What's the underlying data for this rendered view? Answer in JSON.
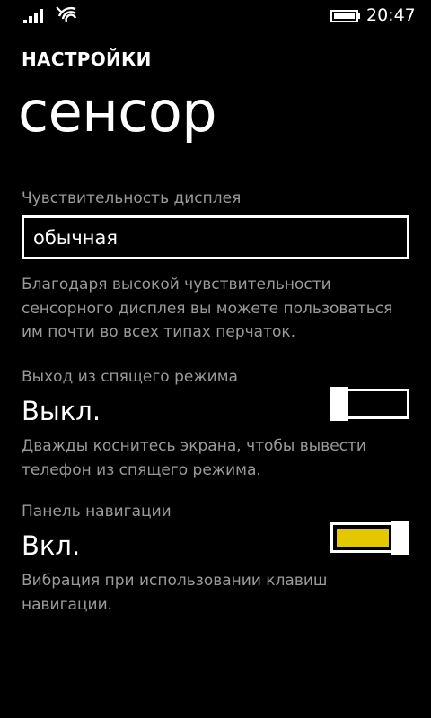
{
  "status_bar": {
    "time": "20:47",
    "icons": [
      "signal-icon",
      "wifi-icon",
      "battery-icon"
    ]
  },
  "header": {
    "app_title": "НАСТРОЙКИ",
    "page_title": "сенсор"
  },
  "sensitivity": {
    "label": "Чувствительность дисплея",
    "value": "обычная",
    "description": "Благодаря высокой чувствительности сенсорного дисплея вы можете пользоваться им почти во всех типах перчаток."
  },
  "wake": {
    "label": "Выход из спящего режима",
    "state": "Выкл.",
    "on": false,
    "description": "Дважды коснитесь экрана, чтобы вывести телефон из спящего режима."
  },
  "navbar": {
    "label": "Панель навигации",
    "state": "Вкл.",
    "on": true,
    "description": "Вибрация при использовании клавиш навигации."
  },
  "colors": {
    "background": "#000000",
    "foreground": "#ffffff",
    "secondary_text": "#9a9a9a",
    "accent": "#e3c800"
  }
}
